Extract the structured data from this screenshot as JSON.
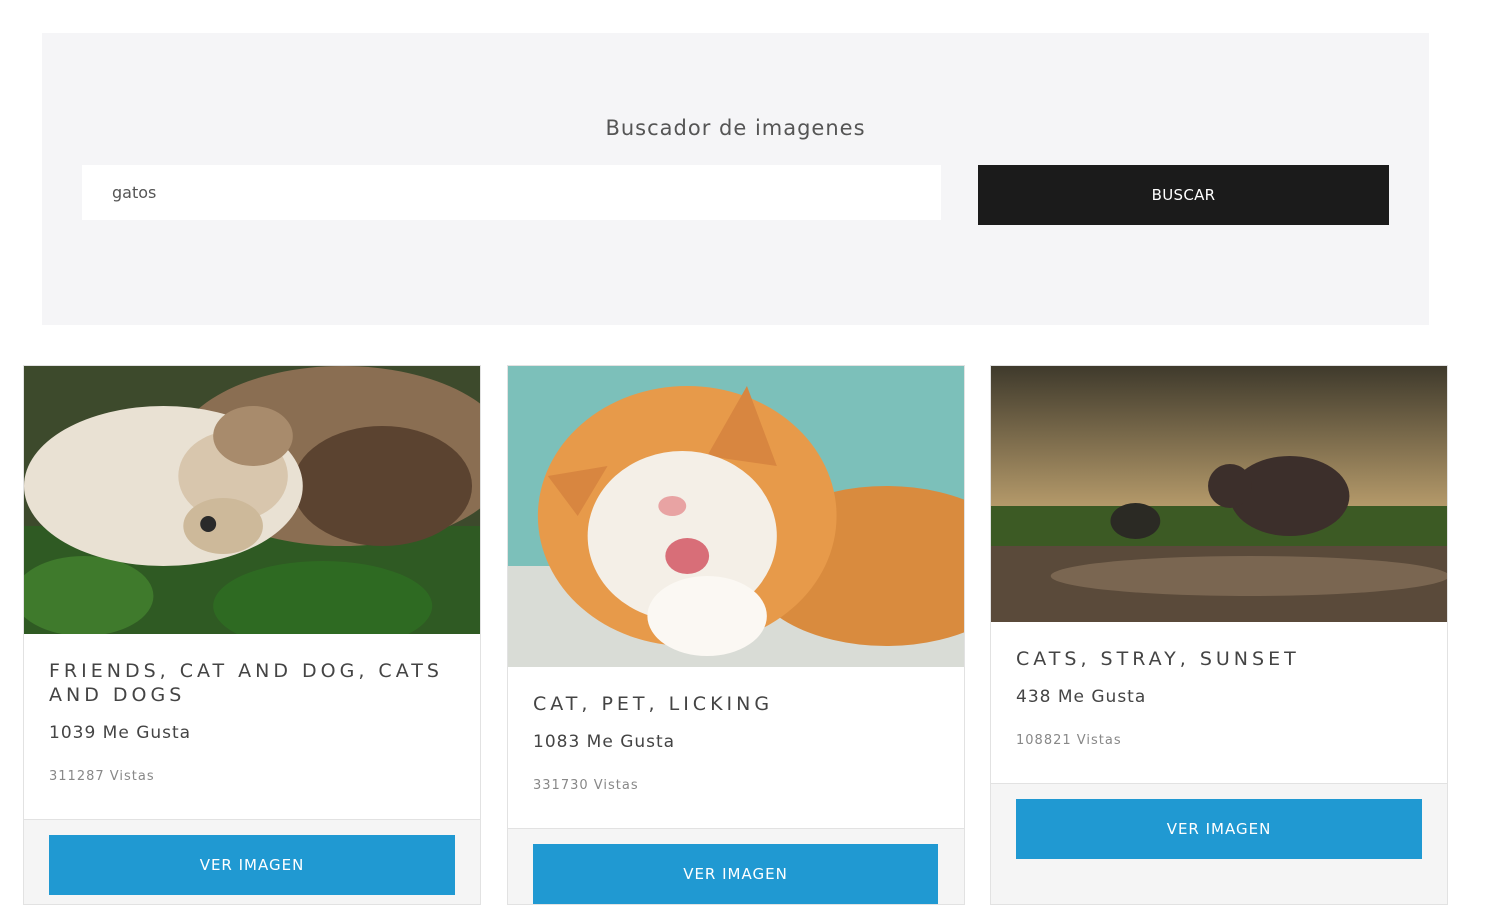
{
  "search": {
    "title": "Buscador de imagenes",
    "query": "gatos",
    "button_label": "BUSCAR"
  },
  "results": [
    {
      "title": "FRIENDS, CAT AND DOG, CATS AND DOGS",
      "likes": "1039 Me Gusta",
      "views": "311287 Vistas",
      "button_label": "VER IMAGEN"
    },
    {
      "title": "CAT, PET, LICKING",
      "likes": "1083 Me Gusta",
      "views": "331730 Vistas",
      "button_label": "VER IMAGEN"
    },
    {
      "title": "CATS, STRAY, SUNSET",
      "likes": "438 Me Gusta",
      "views": "108821 Vistas",
      "button_label": "VER IMAGEN"
    }
  ],
  "colors": {
    "panel_bg": "#f5f5f7",
    "search_button_bg": "#1b1b1b",
    "view_button_bg": "#2099d2"
  }
}
